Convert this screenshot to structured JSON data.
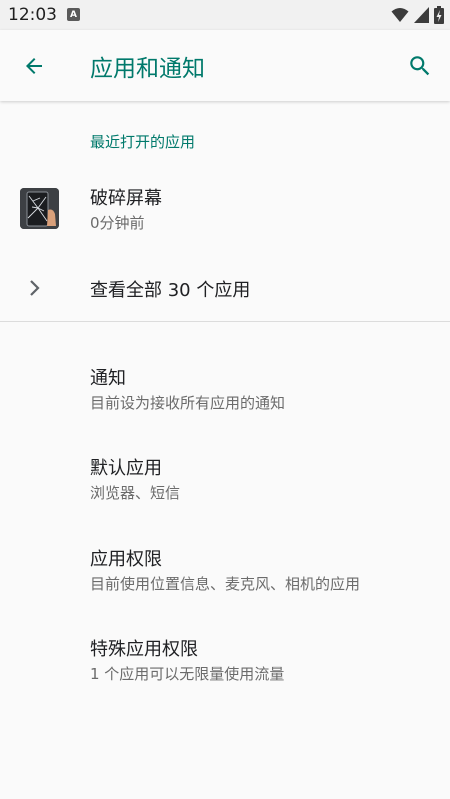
{
  "status_bar": {
    "time": "12:03",
    "notification_badge": "A"
  },
  "app_bar": {
    "title": "应用和通知",
    "back_icon": "arrow-back-icon",
    "search_icon": "search-icon",
    "accent_color": "#00796b"
  },
  "recent": {
    "header": "最近打开的应用",
    "apps": [
      {
        "name": "破碎屏幕",
        "time": "0分钟前",
        "icon": "cracked-screen-app-icon"
      }
    ],
    "see_all_label": "查看全部 30 个应用"
  },
  "preferences": [
    {
      "title": "通知",
      "summary": "目前设为接收所有应用的通知"
    },
    {
      "title": "默认应用",
      "summary": "浏览器、短信"
    },
    {
      "title": "应用权限",
      "summary": "目前使用位置信息、麦克风、相机的应用"
    },
    {
      "title": "特殊应用权限",
      "summary": "1 个应用可以无限量使用流量"
    }
  ]
}
